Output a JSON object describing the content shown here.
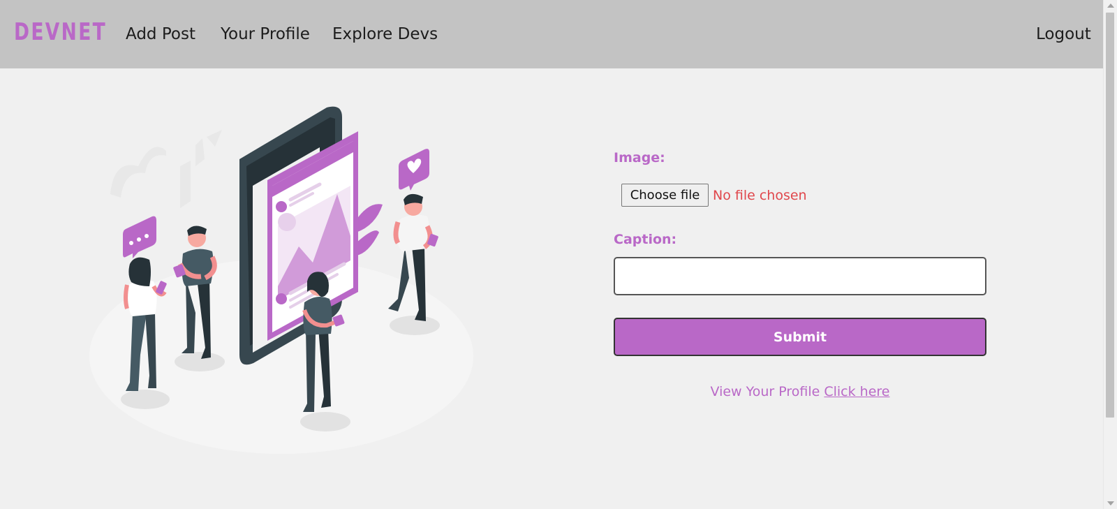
{
  "nav": {
    "logo": "DEVNET",
    "links": [
      "Add Post",
      "Your Profile",
      "Explore Devs"
    ],
    "logout": "Logout"
  },
  "form": {
    "image_label": "Image:",
    "file_button": "Choose file",
    "file_status": "No file chosen",
    "caption_label": "Caption:",
    "caption_value": "",
    "submit_label": "Submit",
    "profile_text": "View Your Profile",
    "profile_link": "Click here"
  },
  "colors": {
    "accent": "#b968c7",
    "navbar_bg": "#c3c3c3",
    "page_bg": "#f0f0f0",
    "error_text": "#e0474c"
  },
  "icons": {
    "illustration": "social-media-people-illustration",
    "chat_bubble": "chat-bubble-icon",
    "heart_bubble": "heart-bubble-icon"
  }
}
